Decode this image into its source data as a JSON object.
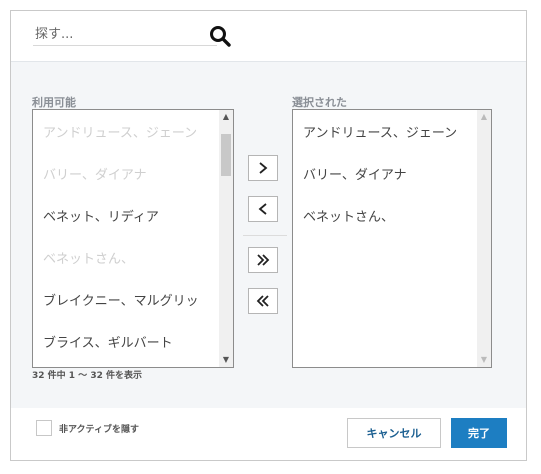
{
  "search": {
    "placeholder": "探す..."
  },
  "available": {
    "label": "利用可能",
    "items": [
      {
        "name": "アンドリュース、ジェーン",
        "disabled": true
      },
      {
        "name": "バリー、ダイアナ",
        "disabled": true
      },
      {
        "name": "ベネット、リディア",
        "disabled": false
      },
      {
        "name": "ベネットさん、",
        "disabled": true
      },
      {
        "name": "ブレイクニー、マルグリッ",
        "disabled": false
      },
      {
        "name": "ブライス、ギルバート",
        "disabled": false
      }
    ],
    "count_text": "32 件中 1 ～ 32 件を表示"
  },
  "selected": {
    "label": "選択された",
    "items": [
      {
        "name": "アンドリュース、ジェーン"
      },
      {
        "name": "バリー、ダイアナ"
      },
      {
        "name": "ベネットさん、"
      }
    ]
  },
  "controls": {
    "move_right": "›",
    "move_left": "‹",
    "move_all_right": "»",
    "move_all_left": "«"
  },
  "footer": {
    "hide_inactive_label": "非アクティブを隠す",
    "hide_inactive_checked": false,
    "cancel_label": "キャンセル",
    "done_label": "完了"
  },
  "colors": {
    "primary": "#1d7ec2",
    "cancel_text": "#1b5f91",
    "panel_bg": "#f4f6f8",
    "disabled_text": "#cfcfcf"
  },
  "icons": [
    "search-icon",
    "chevron-right-icon",
    "chevron-left-icon",
    "double-chevron-right-icon",
    "double-chevron-left-icon",
    "scroll-up-icon",
    "scroll-down-icon"
  ]
}
